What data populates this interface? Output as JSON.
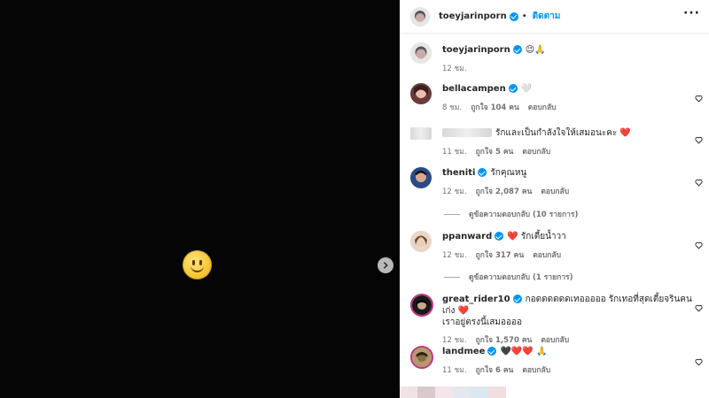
{
  "post": {
    "username": "toeyjarinporn",
    "follow_label": "ติดตาม",
    "more_icon": "more-horizontal-icon",
    "caption_emoji": "😉🙏",
    "caption_time": "12 ชม.",
    "media_emoji": "slightly-smiling-face",
    "next_icon": "chevron-right-icon"
  },
  "comments": [
    {
      "username": "bellacampen",
      "text": "🤍",
      "time": "8 ชม.",
      "likes": "ถูกใจ 104 คน",
      "reply": "ตอบกลับ"
    },
    {
      "username": "",
      "text": "รักและเป็นกำลังใจให้เสมอนะคะ ❤️",
      "time": "11 ชม.",
      "likes": "ถูกใจ 5 คน",
      "reply": "ตอบกลับ"
    },
    {
      "username": "theniti",
      "text": "รักคุณหนู",
      "time": "12 ชม.",
      "likes": "ถูกใจ 2,087 คน",
      "reply": "ตอบกลับ",
      "view_replies": "ดูข้อความตอบกลับ (10 รายการ)"
    },
    {
      "username": "ppanward",
      "text": "❤️ รักเตี้ยน้ำวา",
      "time": "12 ชม.",
      "likes": "ถูกใจ 317 คน",
      "reply": "ตอบกลับ",
      "view_replies": "ดูข้อความตอบกลับ (1 รายการ)"
    },
    {
      "username": "great_rider10",
      "text": "กอดดดดดดเทอออออ รักเทอที่สุดเตี้ยจรินคนเก่ง ❤️",
      "text2": "เราอยู่ตรงนี้เสมออออ",
      "time": "12 ชม.",
      "likes": "ถูกใจ 1,570 คน",
      "reply": "ตอบกลับ"
    },
    {
      "username": "landmee",
      "text": "🖤❤️❤️ 🙏",
      "time": "11 ชม.",
      "likes": "ถูกใจ 6 คน",
      "reply": "ตอบกลับ"
    }
  ],
  "colors": {
    "accent": "#0095f6",
    "heart": "#ed4956",
    "meta": "#737373"
  }
}
